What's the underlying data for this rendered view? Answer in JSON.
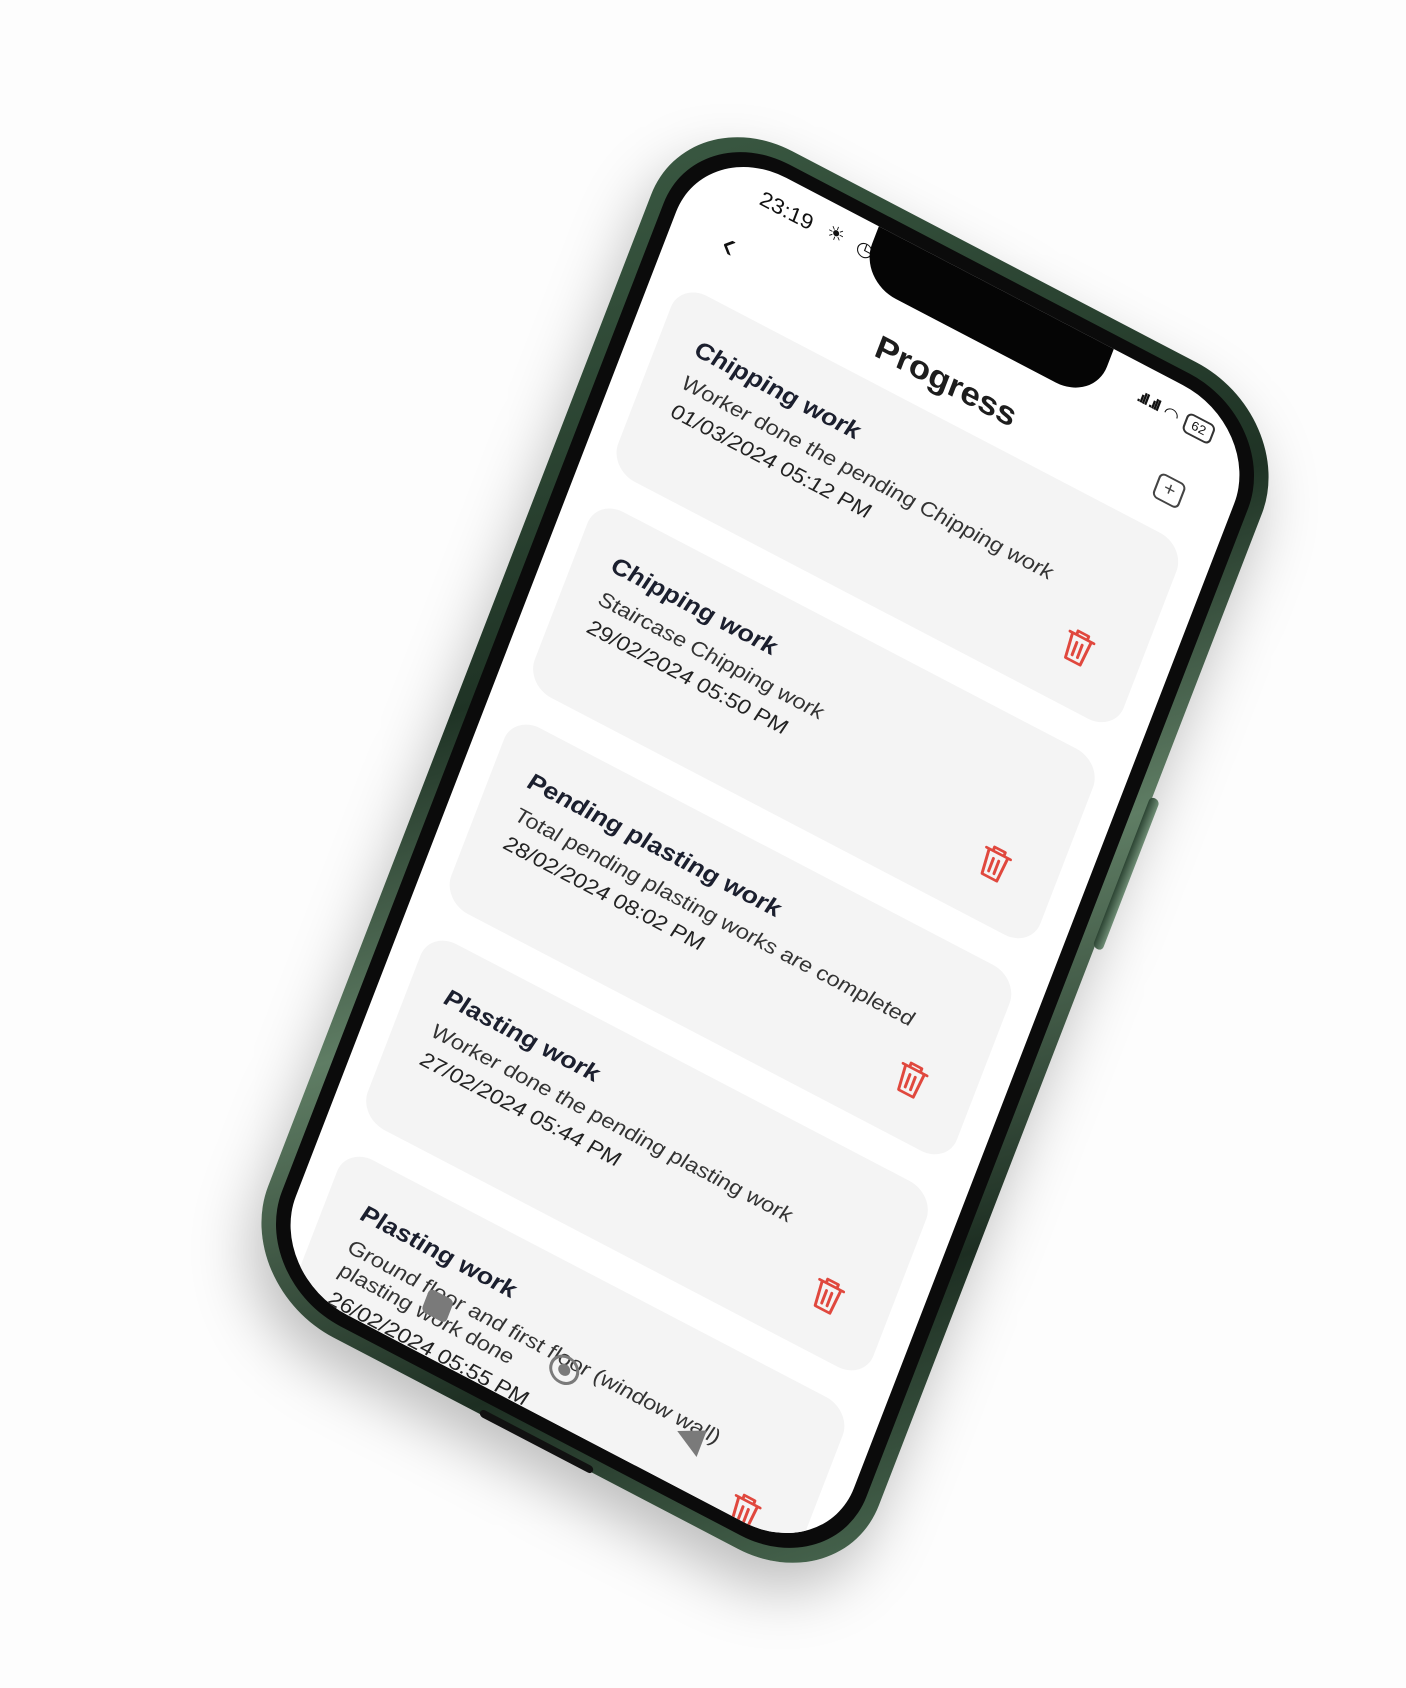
{
  "status": {
    "time": "23:19",
    "icons": "☀ ◷ ▣",
    "signal": ".ıll .ıll",
    "battery": "62"
  },
  "header": {
    "title": "Progress",
    "back_icon": "‹",
    "add_icon": "+"
  },
  "entries": [
    {
      "title": "Chipping work",
      "description": "Worker done the pending Chipping work",
      "date": "01/03/2024 05:12 PM"
    },
    {
      "title": "Chipping work",
      "description": "Staircase Chipping work",
      "date": "29/02/2024 05:50 PM"
    },
    {
      "title": "Pending plasting work",
      "description": "Total pending plasting works are completed",
      "date": "28/02/2024 08:02 PM"
    },
    {
      "title": "Plasting work",
      "description": "Worker done the pending plasting work",
      "date": "27/02/2024 05:44 PM"
    },
    {
      "title": "Plasting work",
      "description": "Ground floor and first floor (window wall) plasting work done",
      "date": "26/02/2024 05:55 PM"
    }
  ],
  "colors": {
    "delete": "#e0483e",
    "card_bg": "#f4f4f4",
    "frame": "#2f4a35"
  }
}
